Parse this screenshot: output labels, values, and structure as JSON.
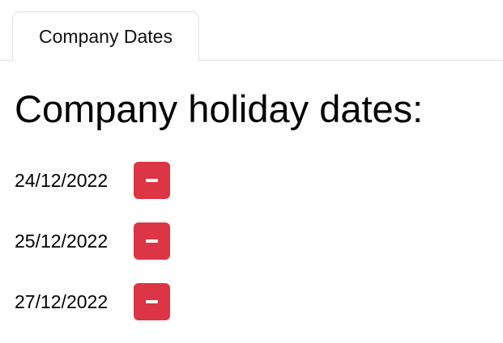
{
  "tabs": [
    {
      "label": "Company Dates"
    }
  ],
  "main": {
    "heading": "Company holiday dates:",
    "dates": [
      {
        "value": "24/12/2022",
        "remove_icon": "minus-icon"
      },
      {
        "value": "25/12/2022",
        "remove_icon": "minus-icon"
      },
      {
        "value": "27/12/2022",
        "remove_icon": "minus-icon"
      }
    ]
  },
  "colors": {
    "remove_button": "#dc3545",
    "tab_border": "#dee2e6"
  }
}
